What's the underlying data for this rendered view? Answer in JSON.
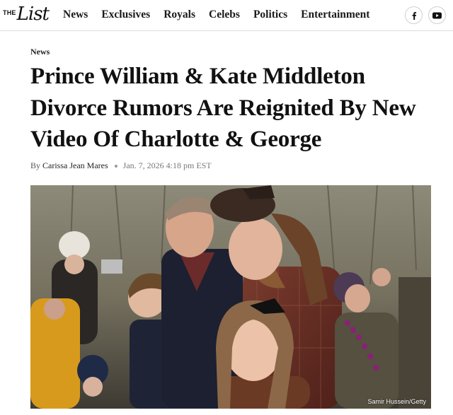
{
  "header": {
    "logo_the": "THE",
    "logo_list": "List",
    "nav": [
      "News",
      "Exclusives",
      "Royals",
      "Celebs",
      "Politics",
      "Entertainment"
    ],
    "social": [
      "facebook-icon",
      "youtube-icon"
    ]
  },
  "article": {
    "category": "News",
    "title": "Prince William & Kate Middleton Divorce Rumors Are Reignited By New Video Of Charlotte & George",
    "byline_prefix": "By",
    "author": "Carissa Jean Mares",
    "date": "Jan. 7, 2026 4:18 pm EST",
    "photo_credit": "Samir Hussein/Getty"
  },
  "colors": {
    "text": "#111111",
    "muted": "#777777",
    "divider": "#dcdcdc"
  }
}
